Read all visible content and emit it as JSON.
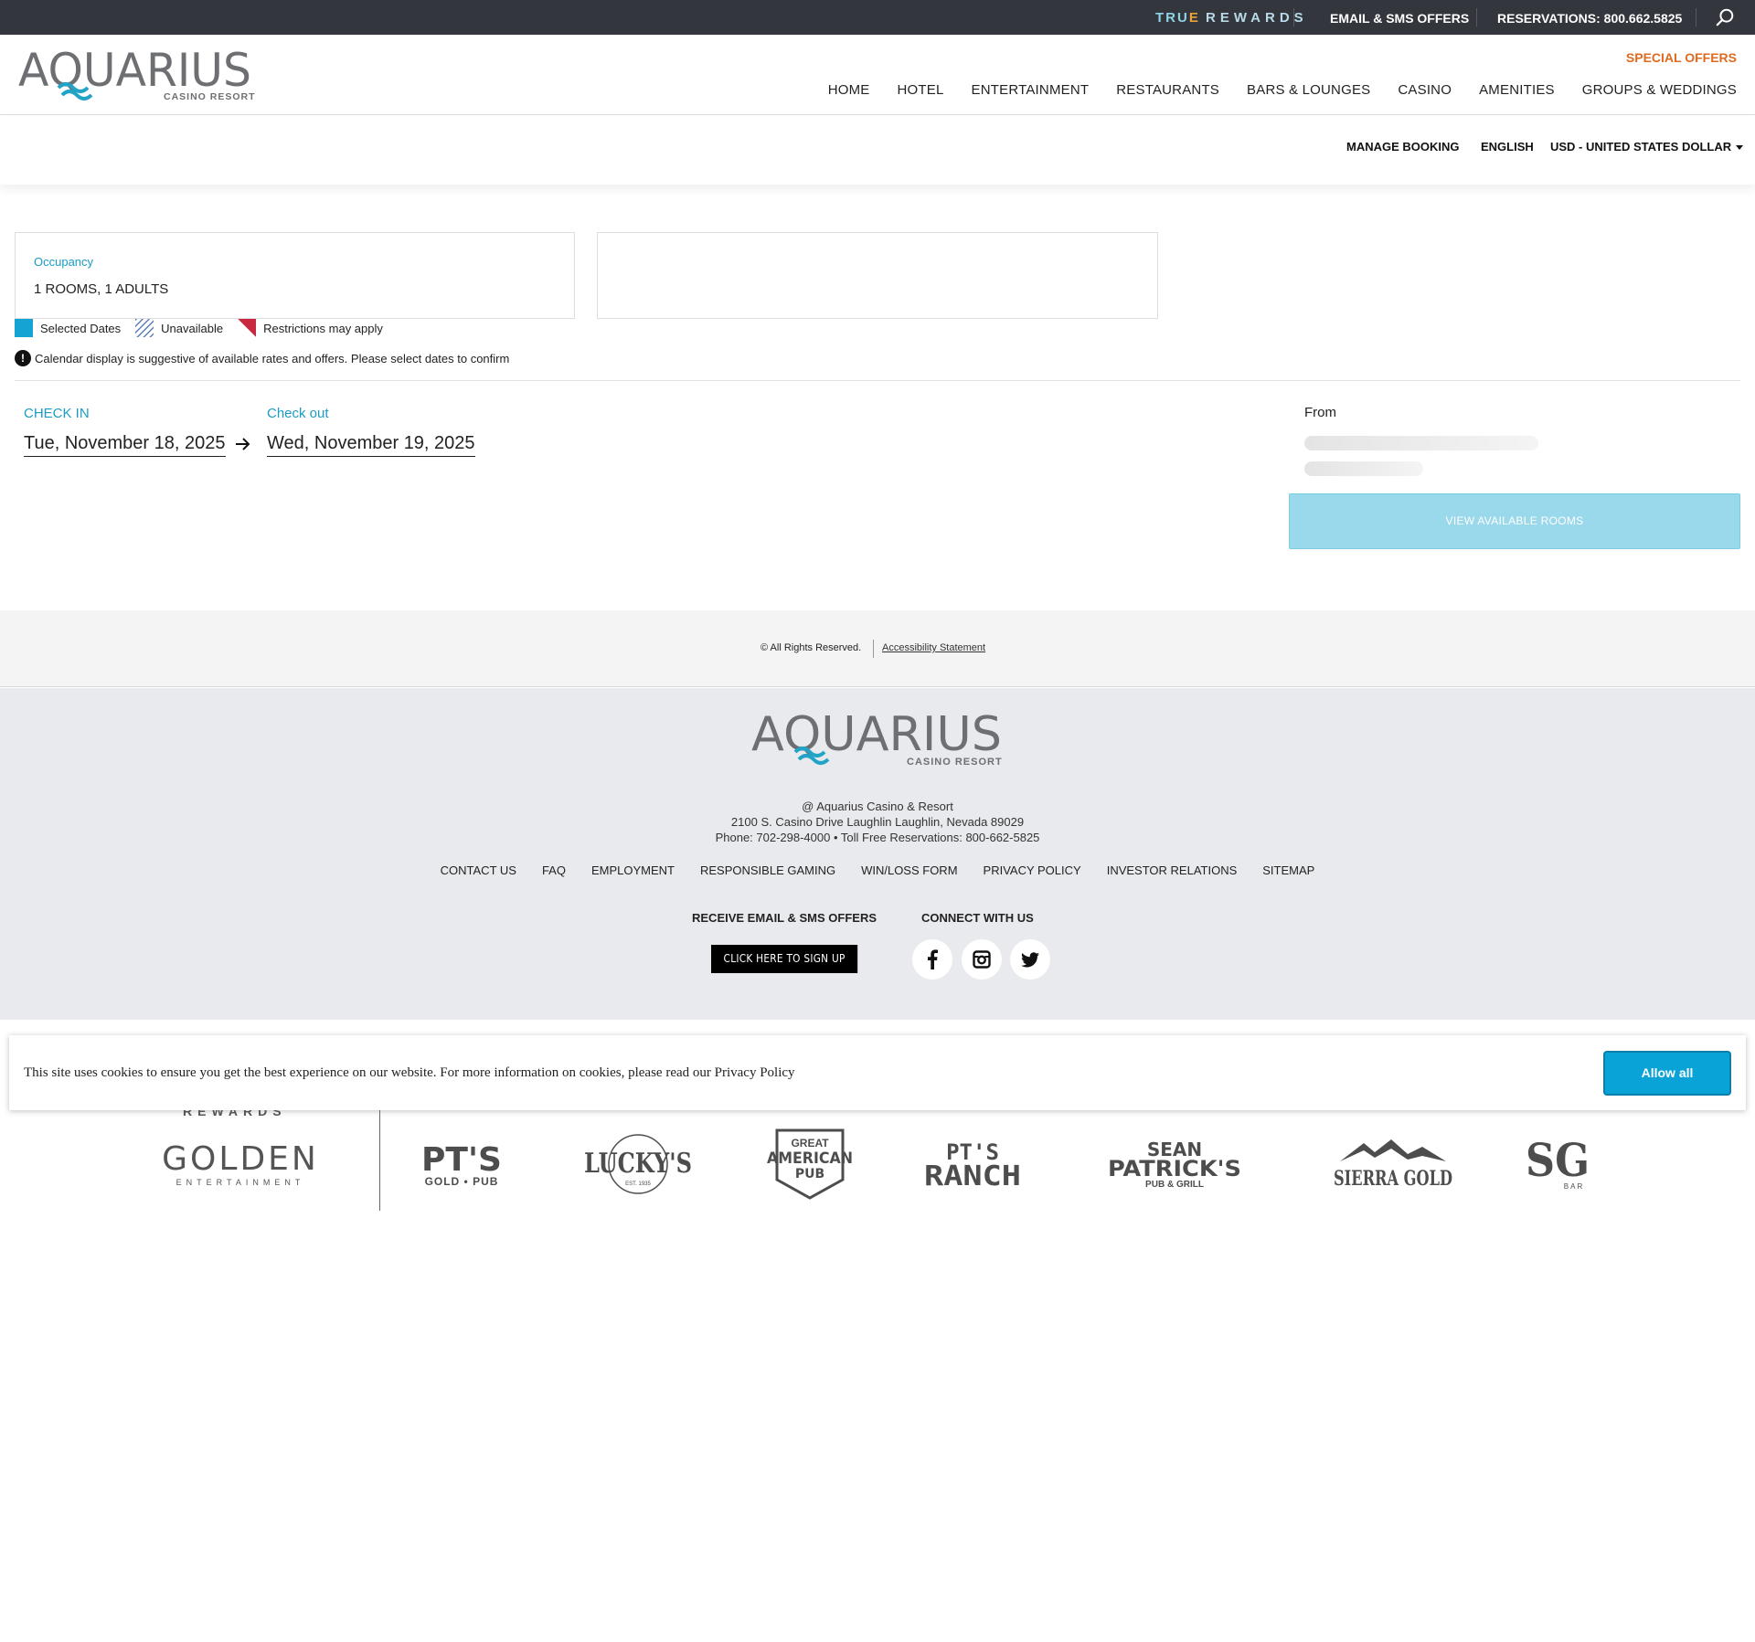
{
  "topbar": {
    "true_rewards": {
      "part1": "TRU",
      "part2": "E",
      "part3": "REWARDS"
    },
    "email_sms": "EMAIL & SMS OFFERS",
    "reservations": "RESERVATIONS: 800.662.5825"
  },
  "header": {
    "logo": {
      "name": "AQUARIUS",
      "sub": "CASINO RESORT"
    },
    "special_offers": "SPECIAL OFFERS",
    "nav": [
      "HOME",
      "HOTEL",
      "ENTERTAINMENT",
      "RESTAURANTS",
      "BARS & LOUNGES",
      "CASINO",
      "AMENITIES",
      "GROUPS & WEDDINGS"
    ]
  },
  "subbar": {
    "manage_booking": "MANAGE BOOKING",
    "language": "ENGLISH",
    "currency": "USD - UNITED STATES DOLLAR"
  },
  "booking": {
    "occupancy_label": "Occupancy",
    "occupancy_value": "1 ROOMS, 1 ADULTS",
    "legend": {
      "selected": "Selected Dates",
      "unavailable": "Unavailable",
      "restrictions": "Restrictions may apply"
    },
    "notice": "Calendar display is suggestive of available rates and offers. Please select dates to confirm",
    "checkin_label": "CHECK IN",
    "checkin_value": "Tue, November 18, 2025",
    "checkout_label": "Check out",
    "checkout_value": "Wed, November 19, 2025",
    "from_label": "From",
    "view_button": "VIEW AVAILABLE ROOMS"
  },
  "copyright": {
    "rights": "© All Rights Reserved.",
    "accessibility": "Accessibility Statement"
  },
  "footer": {
    "logo": {
      "name": "AQUARIUS",
      "sub": "CASINO RESORT"
    },
    "address": {
      "line1": "@ Aquarius Casino & Resort",
      "line2": "2100 S. Casino Drive Laughlin Laughlin, Nevada 89029",
      "line3": "Phone: 702-298-4000 • Toll Free Reservations: 800-662-5825"
    },
    "links": [
      "CONTACT US",
      "FAQ",
      "EMPLOYMENT",
      "RESPONSIBLE GAMING",
      "WIN/LOSS FORM",
      "PRIVACY POLICY",
      "INVESTOR RELATIONS",
      "SITEMAP"
    ],
    "receive_heading": "RECEIVE EMAIL & SMS OFFERS",
    "connect_heading": "CONNECT WITH US",
    "signup_button": "CLICK HERE TO SIGN UP"
  },
  "cookie": {
    "text": "This site uses cookies to ensure you get the best experience on our website. For more information on cookies, please read our Privacy Policy",
    "allow_button": "Allow all"
  },
  "brands": {
    "partial_rewards": "REWARDS",
    "golden": {
      "name": "GOLDEN",
      "sub": "ENTERTAINMENT"
    },
    "pts_gold": {
      "name": "PT'S",
      "sub": "GOLD • PUB"
    },
    "luckys": {
      "name": "LUCKY'S",
      "sub": "EST. 1935"
    },
    "great_american": {
      "line1": "GREAT",
      "line2": "AMERICAN",
      "line3": "PUB"
    },
    "pts_ranch": {
      "line1": "PT'S",
      "line2": "RANCH"
    },
    "sean_patricks": {
      "line1": "SEAN",
      "line2": "PATRICK'S",
      "line3": "PUB & GRILL"
    },
    "sierra_gold": {
      "name": "SIERRA GOLD"
    },
    "sg_bar": {
      "name": "SG",
      "sub": "BAR"
    }
  }
}
